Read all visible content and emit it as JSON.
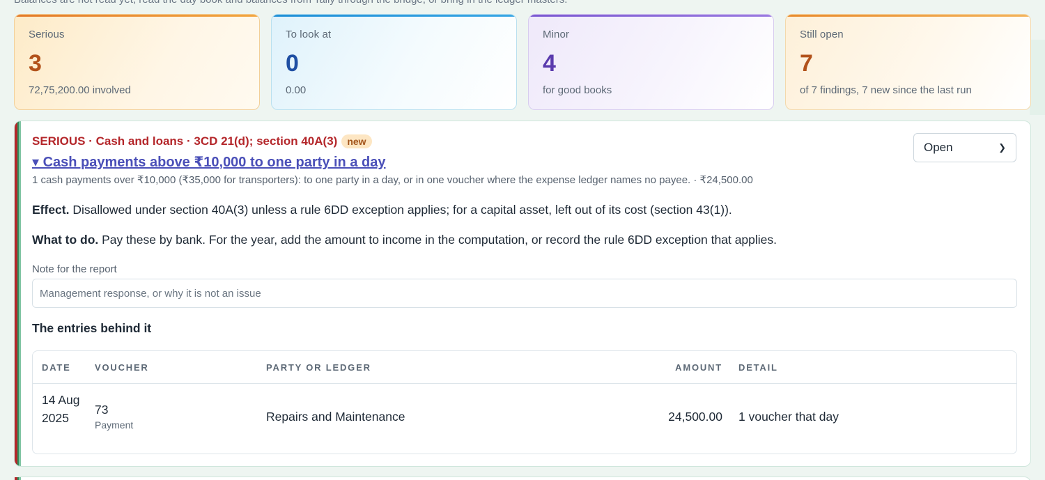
{
  "top_note": "Balances are not read yet, read the day book and balances from Tally through the bridge, or bring in the ledger masters.",
  "summary": {
    "serious": {
      "label": "Serious",
      "count": "3",
      "sub": "72,75,200.00 involved"
    },
    "to_look_at": {
      "label": "To look at",
      "count": "0",
      "sub": "0.00"
    },
    "minor": {
      "label": "Minor",
      "count": "4",
      "sub": "for good books"
    },
    "still_open": {
      "label": "Still open",
      "count": "7",
      "sub": "of 7 findings, 7 new since the last run"
    }
  },
  "finding": {
    "severity_line": "SERIOUS · Cash and loans · 3CD 21(d); section 40A(3)",
    "badge": "new",
    "title": "▾ Cash payments above ₹10,000 to one party in a day",
    "description": "1 cash payments over ₹10,000 (₹35,000 for transporters): to one party in a day, or in one voucher where the expense ledger names no payee. · ₹24,500.00",
    "effect_label": "Effect.",
    "effect_text": " Disallowed under section 40A(3) unless a rule 6DD exception applies; for a capital asset, left out of its cost (section 43(1)).",
    "todo_label": "What to do.",
    "todo_text": " Pay these by bank. For the year, add the amount to income in the computation, or record the rule 6DD exception that applies.",
    "note_label": "Note for the report",
    "note_placeholder": "Management response, or why it is not an issue",
    "note_value": "",
    "status": "Open",
    "entries_title": "The entries behind it",
    "table": {
      "headers": {
        "date": "DATE",
        "voucher": "VOUCHER",
        "party": "PARTY OR LEDGER",
        "amount": "AMOUNT",
        "detail": "DETAIL"
      },
      "rows": [
        {
          "date": "14 Aug 2025",
          "voucher_no": "73",
          "voucher_type": "Payment",
          "party": "Repairs and Maintenance",
          "amount": "24,500.00",
          "detail": "1 voucher that day"
        }
      ]
    }
  },
  "colors": {
    "serious": "#b4262a",
    "link": "#4a4fb8",
    "serious_count": "#b2521b",
    "look_count": "#1f4fa3",
    "minor_count": "#5a3aad"
  }
}
